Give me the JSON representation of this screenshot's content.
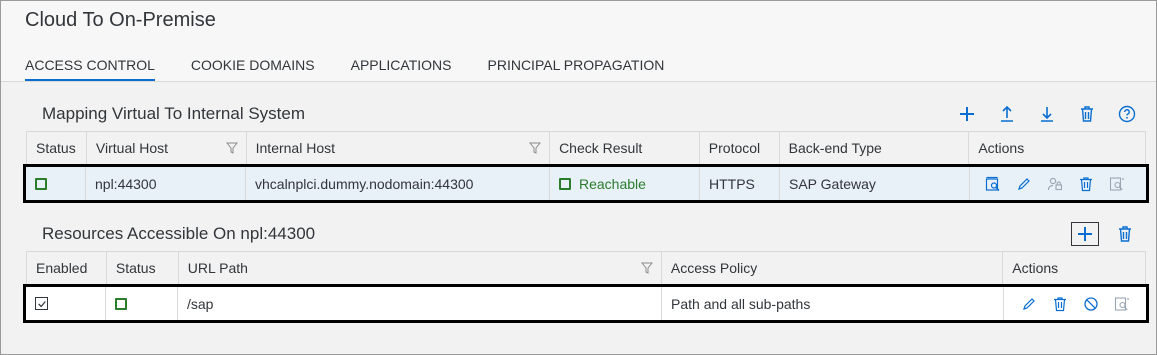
{
  "page": {
    "title": "Cloud To On-Premise",
    "tabs": [
      "ACCESS CONTROL",
      "COOKIE DOMAINS",
      "APPLICATIONS",
      "PRINCIPAL PROPAGATION"
    ]
  },
  "mapping": {
    "title": "Mapping Virtual To Internal System",
    "toolbar_icons": [
      "add-icon",
      "upload-icon",
      "download-icon",
      "delete-icon",
      "help-icon"
    ],
    "columns": [
      "Status",
      "Virtual Host",
      "Internal Host",
      "Check Result",
      "Protocol",
      "Back-end Type",
      "Actions"
    ],
    "row": {
      "virtual_host": "npl:44300",
      "internal_host": "vhcalnplci.dummy.nodomain:44300",
      "check_result": "Reachable",
      "protocol": "HTTPS",
      "backend_type": "SAP Gateway"
    },
    "row_action_icons": [
      "check-availability-icon",
      "edit-icon",
      "principal-type-icon",
      "delete-icon",
      "view-details-icon"
    ]
  },
  "resources": {
    "title": "Resources Accessible On npl:44300",
    "toolbar_icons": [
      "add-icon",
      "delete-icon"
    ],
    "columns": [
      "Enabled",
      "Status",
      "URL Path",
      "Access Policy",
      "Actions"
    ],
    "row": {
      "enabled": true,
      "url_path": "/sap",
      "access_policy": "Path and all sub-paths"
    },
    "row_action_icons": [
      "edit-icon",
      "delete-icon",
      "disable-icon",
      "view-details-icon"
    ]
  },
  "colors": {
    "accent": "#0a6ed1",
    "icon": "#0a6ed1",
    "status_green": "#2b7d2b",
    "selected_row": "#e8f0f8"
  }
}
